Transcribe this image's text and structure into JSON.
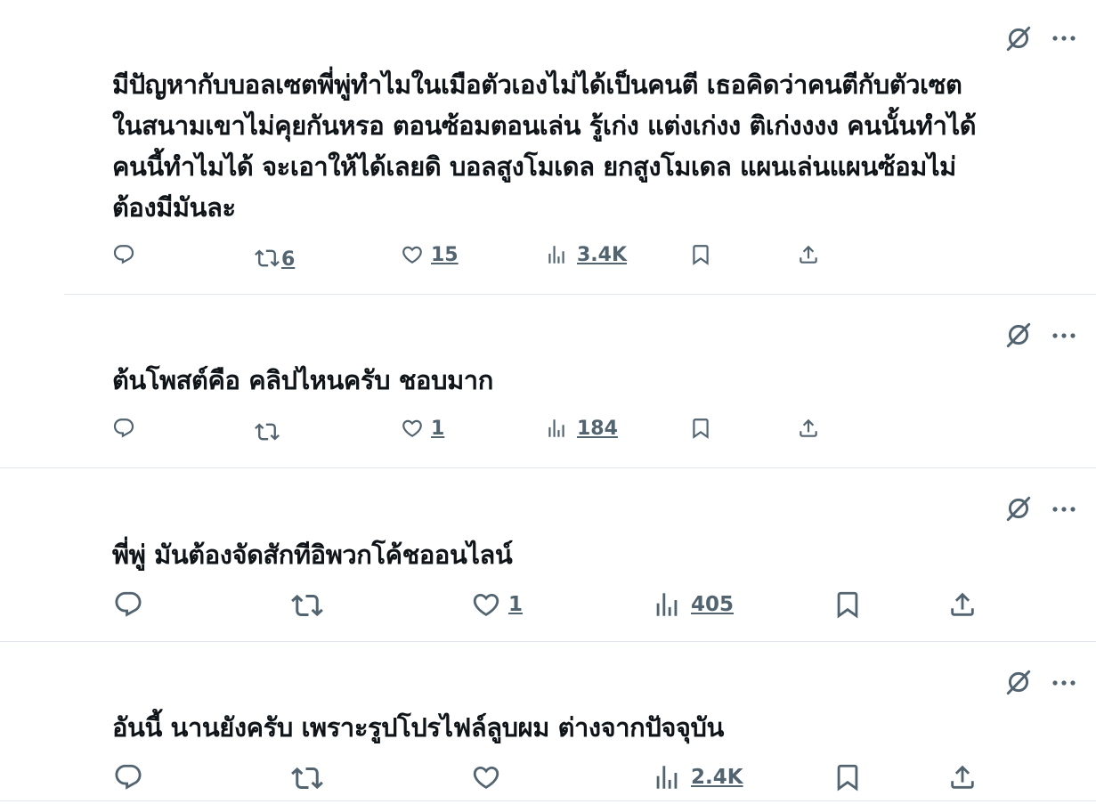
{
  "colors": {
    "icon": "#536471",
    "text": "#0f1419",
    "separator": "#e1e6ea"
  },
  "posts": [
    {
      "text": "มีปัญหากับบอลเซตพี่พู่ทำไมในเมือตัวเองไม่ได้เป็นคนตี เธอคิดว่าคนตีกับตัวเซต\nในสนามเขาไม่คุยกันหรอ ตอนซ้อมตอนเล่น รู้เก่ง แต่งเก่งง ติเก่งงงง คนนั้นทำได้\nคนนี้ทำไมได้ จะเอาให้ได้เลยดิ บอลสูงโมเดล ยกสูงโมเดล แผนเล่นแผนซ้อมไม่\nต้องมีมันละ",
      "reposts": "6",
      "likes": "15",
      "views": "3.4K"
    },
    {
      "text": "ต้นโพสต์คือ คลิปไหนครับ ชอบมาก",
      "reposts": "",
      "likes": "1",
      "views": "184"
    },
    {
      "text": "พี่พู่ มันต้องจัดสักทีอิพวกโค้ชออนไลน์",
      "reposts": "",
      "likes": "1",
      "views": "405"
    },
    {
      "text": "อันนี้ นานยังครับ เพราะรูปโปรไฟล์ลูบผม ต่างจากปัจจุบัน",
      "reposts": "",
      "likes": "",
      "views": "2.4K"
    }
  ],
  "icons": {
    "grok": "grok-slash-icon",
    "more": "more-dots-icon",
    "reply": "reply-bubble-icon",
    "repost": "repost-arrows-icon",
    "like": "heart-icon",
    "views": "views-bars-icon",
    "bookmark": "bookmark-icon",
    "share": "share-upload-icon"
  }
}
